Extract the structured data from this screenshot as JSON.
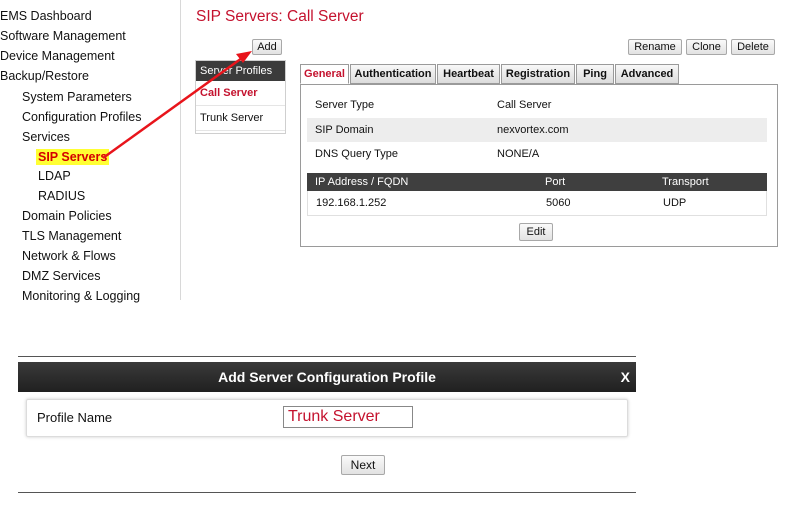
{
  "nav": {
    "items": [
      {
        "label": "EMS Dashboard"
      },
      {
        "label": "Software Management"
      },
      {
        "label": "Device Management"
      },
      {
        "label": "Backup/Restore"
      },
      {
        "label": "System Parameters"
      },
      {
        "label": "Configuration Profiles"
      },
      {
        "label": "Services"
      },
      {
        "label": "SIP Servers"
      },
      {
        "label": "LDAP"
      },
      {
        "label": "RADIUS"
      },
      {
        "label": "Domain Policies"
      },
      {
        "label": "TLS Management"
      },
      {
        "label": "Network & Flows"
      },
      {
        "label": "DMZ Services"
      },
      {
        "label": "Monitoring & Logging"
      }
    ]
  },
  "page": {
    "title": "SIP Servers: Call Server",
    "add_label": "Add",
    "rename_label": "Rename",
    "clone_label": "Clone",
    "delete_label": "Delete",
    "edit_label": "Edit"
  },
  "profiles": {
    "header": "Server Profiles",
    "items": [
      "Call Server",
      "Trunk Server"
    ]
  },
  "tabs": [
    "General",
    "Authentication",
    "Heartbeat",
    "Registration",
    "Ping",
    "Advanced"
  ],
  "general": {
    "rows": [
      {
        "key": "Server Type",
        "value": "Call Server"
      },
      {
        "key": "SIP Domain",
        "value": "nexvortex.com"
      },
      {
        "key": "DNS Query Type",
        "value": "NONE/A"
      }
    ],
    "ip_table": {
      "headers": [
        "IP Address / FQDN",
        "Port",
        "Transport"
      ],
      "rows": [
        [
          "192.168.1.252",
          "5060",
          "UDP"
        ]
      ]
    }
  },
  "dialog": {
    "title": "Add Server Configuration Profile",
    "close_label": "X",
    "field_label": "Profile Name",
    "field_value": "Trunk Server",
    "next_label": "Next"
  },
  "colors": {
    "accent": "#c4122e",
    "arrow": "#e8141b",
    "highlight": "#ffff33"
  }
}
